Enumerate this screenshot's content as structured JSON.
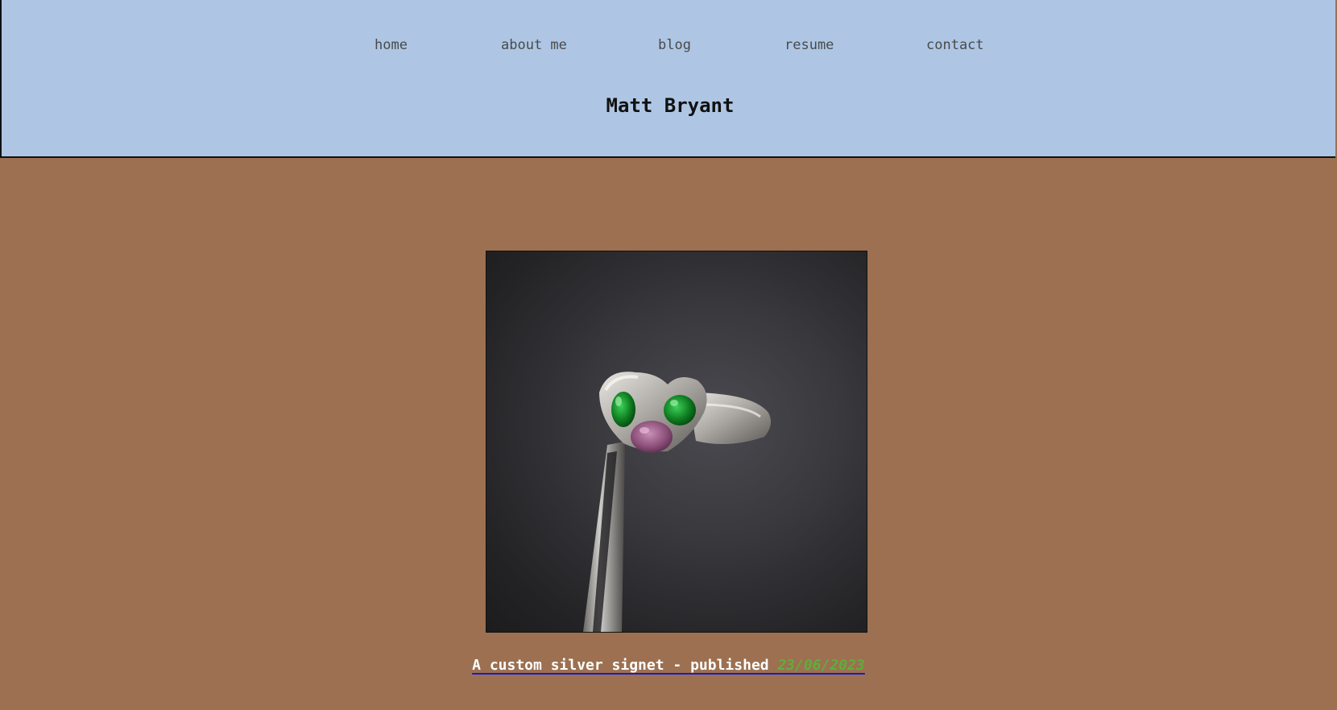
{
  "nav": {
    "items": [
      {
        "label": "home"
      },
      {
        "label": "about me"
      },
      {
        "label": "blog"
      },
      {
        "label": "resume"
      },
      {
        "label": "contact"
      }
    ]
  },
  "header": {
    "title": "Matt Bryant"
  },
  "post": {
    "caption_text": "A custom silver signet - published ",
    "date": "23/06/2023"
  },
  "colors": {
    "header_bg": "#aec6e4",
    "page_bg": "#9c7051",
    "date_green": "#5fae3a",
    "link_underline": "#1a1acc"
  }
}
